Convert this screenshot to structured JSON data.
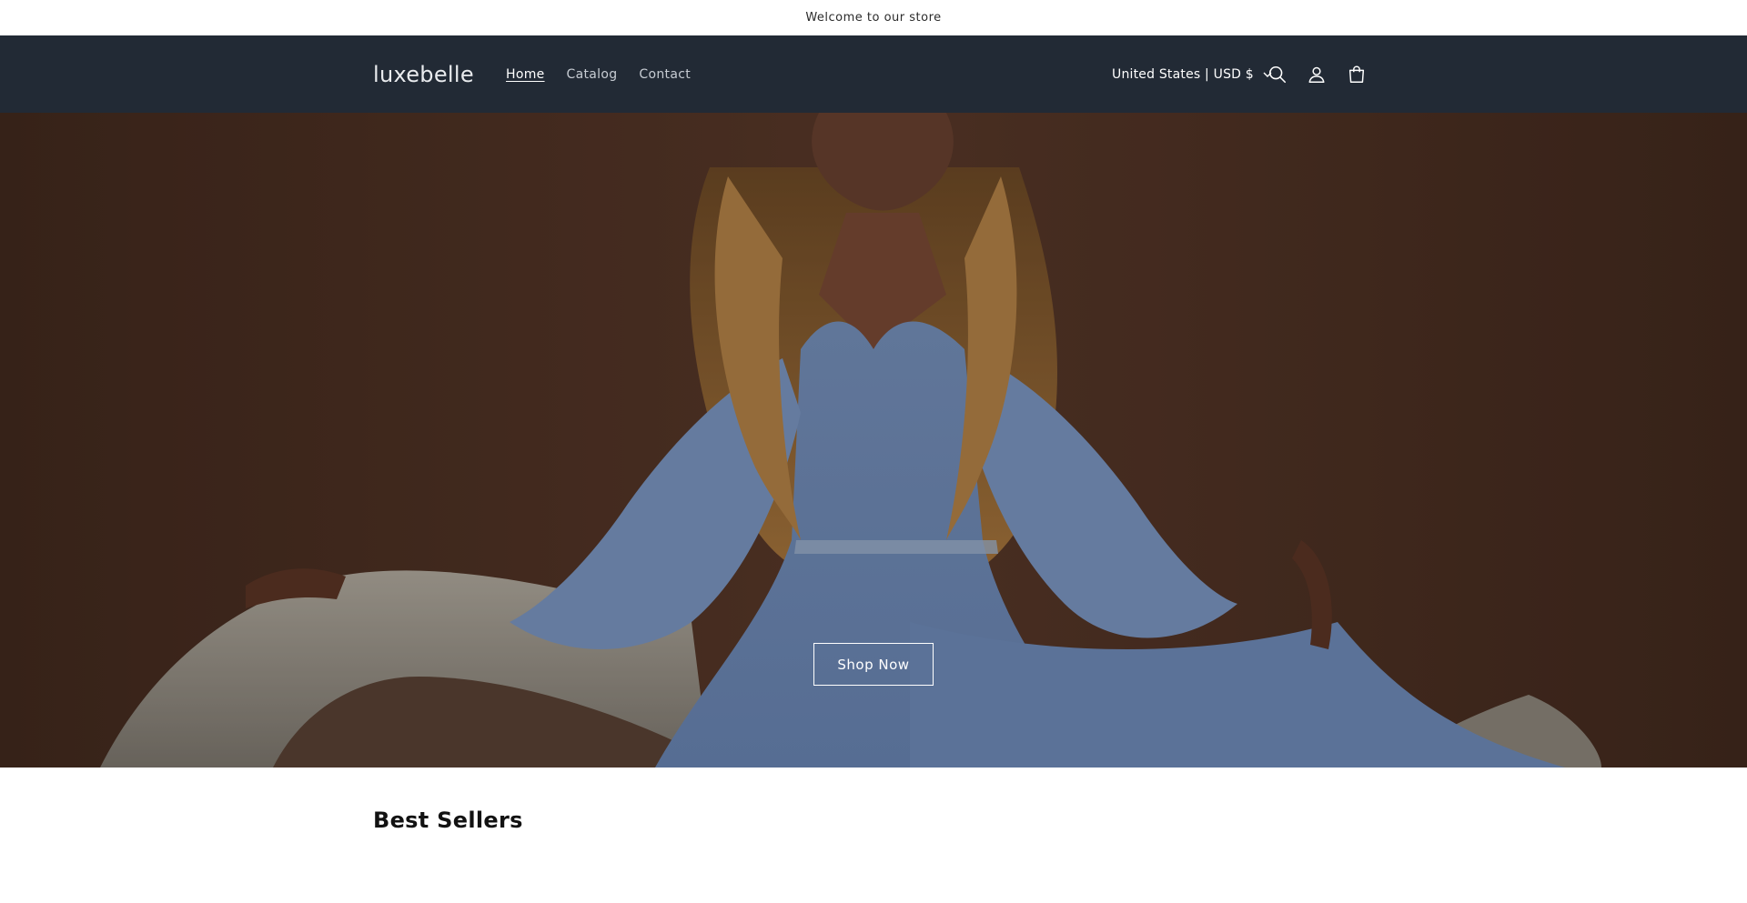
{
  "announcement": {
    "text": "Welcome to our store"
  },
  "header": {
    "logo": "luxebelle",
    "nav": [
      {
        "label": "Home",
        "active": true
      },
      {
        "label": "Catalog",
        "active": false
      },
      {
        "label": "Contact",
        "active": false
      }
    ],
    "country_selector": "United States | USD $",
    "icons": [
      "search-icon",
      "account-icon",
      "cart-icon"
    ],
    "background_color": "#222a35"
  },
  "hero": {
    "button_label": "Shop Now",
    "background_color": "#4a2e22",
    "dress_color": "#7d98c4"
  },
  "sections": {
    "best_sellers_title": "Best Sellers"
  }
}
